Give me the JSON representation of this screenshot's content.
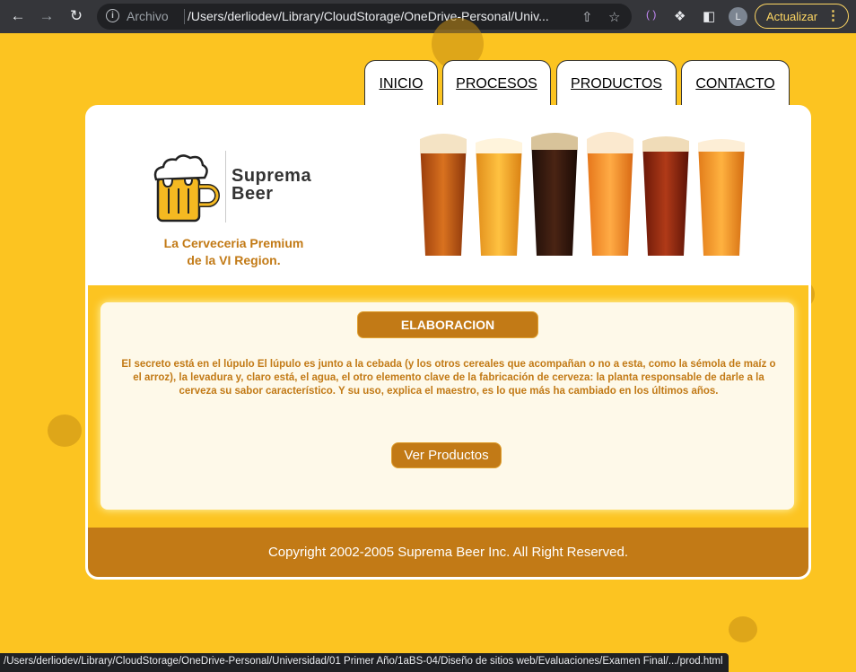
{
  "browser": {
    "back_icon": "arrow-left-icon",
    "forward_icon": "arrow-right-icon",
    "reload_icon": "reload-icon",
    "info_icon": "info-icon",
    "protocol_label": "Archivo",
    "url": "/Users/derliodev/Library/CloudStorage/OneDrive-Personal/Univ...",
    "update_label": "Actualizar",
    "avatar_letter": "L"
  },
  "nav": {
    "items": [
      {
        "label": "INICIO"
      },
      {
        "label": "PROCESOS"
      },
      {
        "label": "PRODUCTOS"
      },
      {
        "label": "CONTACTO"
      }
    ]
  },
  "header": {
    "logo_line1": "Suprema",
    "logo_line2": "Beer",
    "tagline_line1": "La Cerveceria Premium",
    "tagline_line2": "de la VI Region."
  },
  "content": {
    "title": "ELABORACION",
    "body": "El secreto está en el lúpulo El lúpulo es junto a la cebada (y los otros cereales que acompañan o no a esta, como la sémola de maíz o el arroz), la levadura y, claro está, el agua, el otro elemento clave de la fabricación de cerveza: la planta responsable de darle a la cerveza su sabor característico. Y su uso, explica el maestro, es lo que más ha cambiado en los últimos años.",
    "cta_label": "Ver Productos"
  },
  "footer": {
    "copyright": "Copyright 2002-2005 Suprema Beer Inc. All Right Reserved."
  },
  "status_bar": {
    "text": "/Users/derliodev/Library/CloudStorage/OneDrive-Personal/Universidad/01 Primer Año/1aBS-04/Diseño de sitios web/Evaluaciones/Examen Final/.../prod.html"
  },
  "colors": {
    "background": "#fcc421",
    "accent": "#c27a16",
    "content_bg": "#fef9e9"
  }
}
